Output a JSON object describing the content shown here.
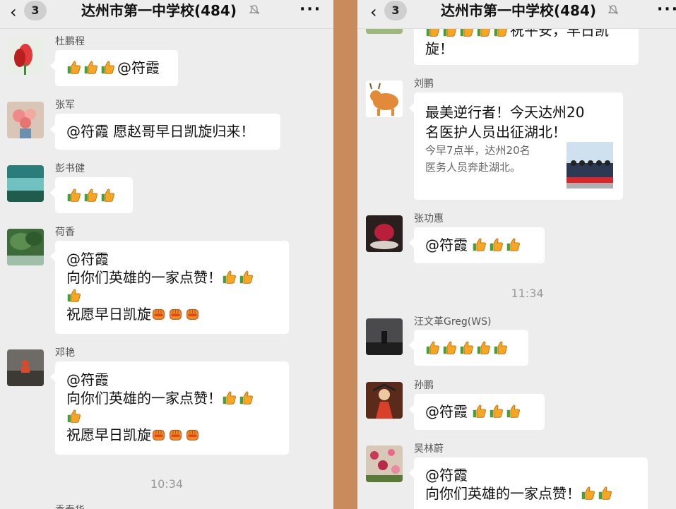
{
  "left_panel": {
    "header": {
      "badge": "3",
      "title": "达州市第一中学校(484)"
    },
    "messages": [
      {
        "sender": "杜鹏程",
        "text": "@符霞"
      },
      {
        "sender": "张军",
        "text": "@符霞 愿赵哥早日凯旋归来！"
      },
      {
        "sender": "彭书健"
      },
      {
        "sender": "荷香",
        "line1": "@符霞",
        "line2": " 向你们英雄的一家点赞！",
        "line3": "祝愿早日凯旋"
      },
      {
        "sender": "邓艳",
        "line1": "@符霞",
        "line2": " 向你们英雄的一家点赞！",
        "line3": "祝愿早日凯旋"
      }
    ],
    "time": "10:34",
    "partial_sender": "季春华"
  },
  "right_panel": {
    "header": {
      "badge": "3",
      "title": "达州市第一中学校(484)"
    },
    "top_partial": {
      "text1": "祝平安，早日凯",
      "text2": "旋！"
    },
    "card": {
      "sender": "刘鹏",
      "title_line1": "最美逆行者！今天达州20",
      "title_line2": "名医护人员出征湖北！",
      "desc_line1": "今早7点半，达州20名",
      "desc_line2": "医务人员奔赴湖北。"
    },
    "messages": [
      {
        "sender": "张功惠",
        "text": "@符霞"
      },
      {
        "sender": "汪文革Greg(WS)"
      },
      {
        "sender": "孙鹏",
        "text": "@符霞"
      },
      {
        "sender": "吴林蔚",
        "line1": "@符霞",
        "line2": " 向你们英雄的一家点赞！"
      }
    ],
    "time": "11:34"
  },
  "icons": {
    "thumbs": "thumbs-up-emoji",
    "fist": "fist-emoji",
    "mute": "mute-bell-icon",
    "more": "more-icon",
    "back": "back-chevron-icon"
  }
}
